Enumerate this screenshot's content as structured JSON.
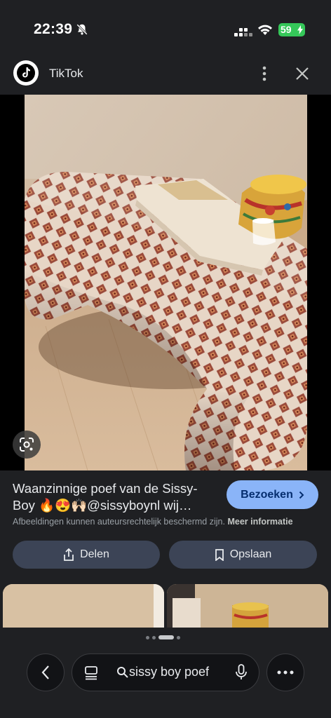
{
  "status_bar": {
    "time": "22:39",
    "battery": "59",
    "icons": [
      "bell-slash-icon",
      "signal-icon",
      "wifi-icon",
      "battery-icon"
    ],
    "battery_color": "#35c759"
  },
  "header": {
    "source_name": "TikTok",
    "icons": [
      "tiktok-logo",
      "more-vert-icon",
      "close-icon"
    ]
  },
  "image": {
    "icons": [
      "lens-icon"
    ]
  },
  "result": {
    "title_line1": "Waanzinnige poef van de Sissy-",
    "title_line2": "Boy 🔥😍🙌🏻@sissyboynl wij…",
    "visit_label": "Bezoeken",
    "copyright_text": "Afbeeldingen kunnen auteursrechtelijk beschermd zijn.",
    "copyright_link": "Meer informatie",
    "visit_color": "#8ab4f8"
  },
  "actions": {
    "share_label": "Delen",
    "save_label": "Opslaan"
  },
  "bottom_bar": {
    "search_query": "sissy boy poef",
    "icons": [
      "back-arrow-icon",
      "list-icon",
      "search-icon",
      "mic-icon",
      "more-horiz-icon"
    ],
    "page_dots": 4,
    "active_dot": 3
  }
}
